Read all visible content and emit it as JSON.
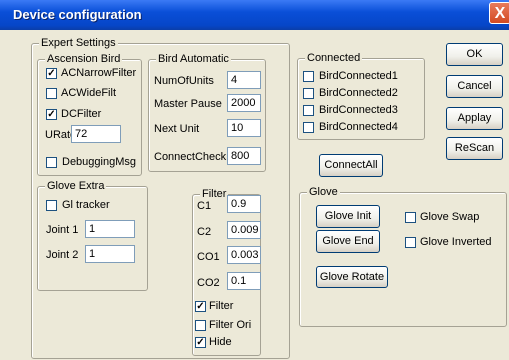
{
  "window": {
    "title": "Device configuration",
    "close_label": "X"
  },
  "expert": {
    "legend": "Expert Settings",
    "ascension": {
      "legend": "Ascension Bird",
      "ac_narrow": {
        "label": "ACNarrowFilter",
        "checked": true
      },
      "ac_wide": {
        "label": "ACWideFilt",
        "checked": false
      },
      "dc_filter": {
        "label": "DCFilter",
        "checked": true
      },
      "urate": {
        "label": "URate",
        "value": "72"
      }
    },
    "debugging": {
      "label": "DebuggingMsg",
      "checked": false
    },
    "bird_automatic": {
      "legend": "Bird Automatic",
      "num_units": {
        "label": "NumOfUnits",
        "value": "4"
      },
      "master_pause": {
        "label": "Master Pause",
        "value": "2000"
      },
      "next_unit": {
        "label": "Next Unit",
        "value": "10"
      },
      "connect_check": {
        "label": "ConnectCheck",
        "value": "800"
      }
    },
    "glove_extra": {
      "legend": "Glove Extra",
      "gl_tracker": {
        "label": "Gl tracker",
        "checked": false
      },
      "joint1": {
        "label": "Joint 1",
        "value": "1"
      },
      "joint2": {
        "label": "Joint 2",
        "value": "1"
      }
    },
    "filter": {
      "legend": "Filter",
      "c1": {
        "label": "C1",
        "value": "0.9"
      },
      "c2": {
        "label": "C2",
        "value": "0.009"
      },
      "co1": {
        "label": "CO1",
        "value": "0.003"
      },
      "co2": {
        "label": "CO2",
        "value": "0.1"
      },
      "filter_chk": {
        "label": "Filter",
        "checked": true
      },
      "filter_ori": {
        "label": "Filter Ori",
        "checked": false
      },
      "hide": {
        "label": "Hide",
        "checked": true
      }
    }
  },
  "connected": {
    "legend": "Connected",
    "birds": [
      {
        "label": "BirdConnected1",
        "checked": false
      },
      {
        "label": "BirdConnected2",
        "checked": false
      },
      {
        "label": "BirdConnected3",
        "checked": false
      },
      {
        "label": "BirdConnected4",
        "checked": false
      }
    ],
    "connect_all": "ConnectAll"
  },
  "glove": {
    "legend": "Glove",
    "init": "Glove Init",
    "end": "Glove End",
    "rotate": "Glove Rotate",
    "swap": {
      "label": "Glove Swap",
      "checked": false
    },
    "inverted": {
      "label": "Glove Inverted",
      "checked": false
    }
  },
  "buttons": {
    "ok": "OK",
    "cancel": "Cancel",
    "applay": "Applay",
    "rescan": "ReScan"
  }
}
